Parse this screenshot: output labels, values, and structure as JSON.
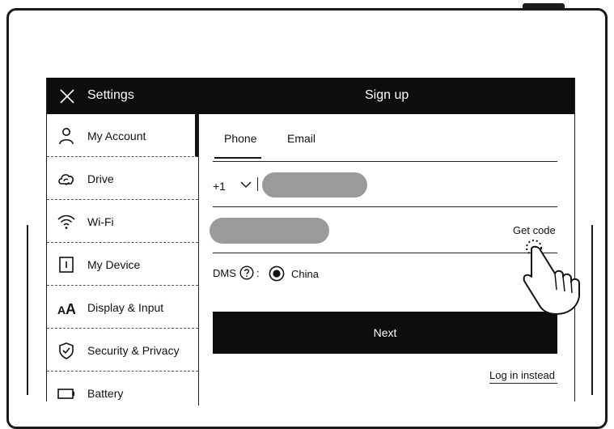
{
  "titlebar": {
    "settings": "Settings",
    "signup": "Sign up"
  },
  "sidebar": {
    "items": [
      {
        "label": "My Account",
        "icon": "person-icon"
      },
      {
        "label": "Drive",
        "icon": "cloud-sync-icon"
      },
      {
        "label": "Wi-Fi",
        "icon": "wifi-icon"
      },
      {
        "label": "My Device",
        "icon": "device-icon"
      },
      {
        "label": "Display & Input",
        "icon": "font-size-icon"
      },
      {
        "label": "Security & Privacy",
        "icon": "shield-check-icon"
      },
      {
        "label": "Battery",
        "icon": "battery-icon"
      }
    ]
  },
  "signup": {
    "tabs": {
      "phone": "Phone",
      "email": "Email"
    },
    "country_code": "+1",
    "get_code": "Get code",
    "dms_label": "DMS",
    "colon": ":",
    "dms_option": "China",
    "next": "Next",
    "login_instead": "Log in instead"
  }
}
